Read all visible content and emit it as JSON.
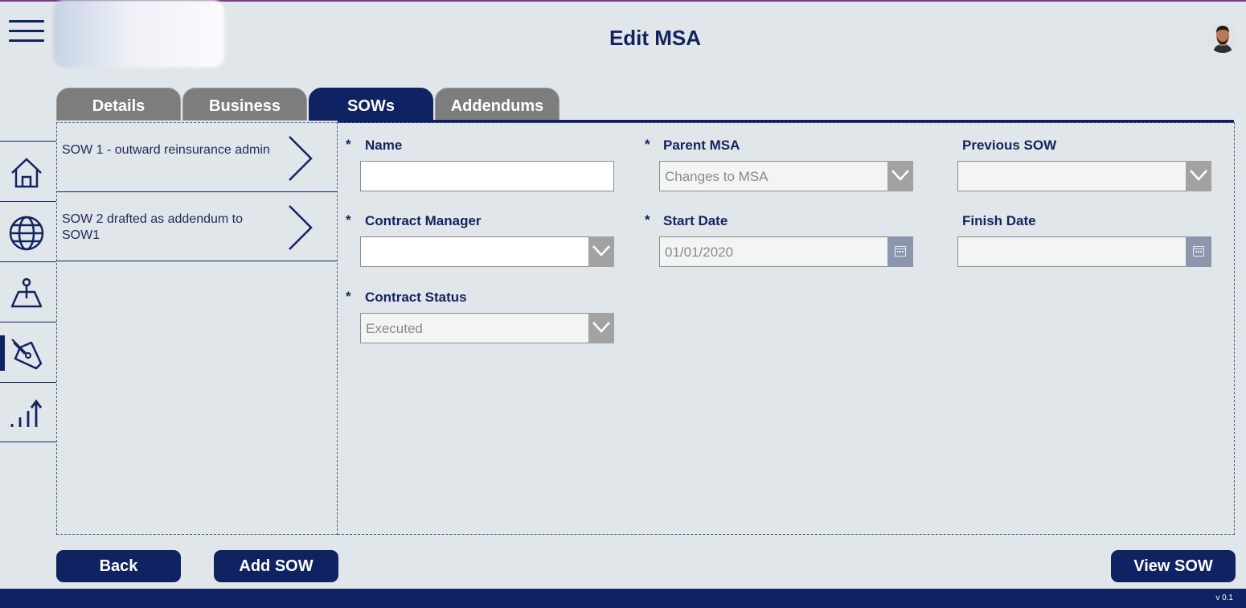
{
  "header": {
    "title": "Edit MSA"
  },
  "tabs": [
    {
      "label": "Details",
      "active": false
    },
    {
      "label": "Business",
      "active": false
    },
    {
      "label": "SOWs",
      "active": true
    },
    {
      "label": "Addendums",
      "active": false
    }
  ],
  "sidenav": {
    "items": [
      {
        "icon": "home-icon",
        "active": false
      },
      {
        "icon": "globe-icon",
        "active": false
      },
      {
        "icon": "map-pin-icon",
        "active": false
      },
      {
        "icon": "pen-nib-icon",
        "active": true
      },
      {
        "icon": "chart-trend-icon",
        "active": false
      }
    ]
  },
  "sow_list": [
    {
      "label": "SOW 1 - outward reinsurance admin"
    },
    {
      "label": "SOW 2 drafted as addendum to SOW1"
    }
  ],
  "form": {
    "required_marker": "*",
    "name": {
      "label": "Name",
      "value": ""
    },
    "parent_msa": {
      "label": "Parent MSA",
      "value": "Changes to MSA"
    },
    "previous_sow": {
      "label": "Previous SOW",
      "value": ""
    },
    "contract_manager": {
      "label": "Contract Manager",
      "value": ""
    },
    "start_date": {
      "label": "Start Date",
      "value": "01/01/2020"
    },
    "finish_date": {
      "label": "Finish Date",
      "value": ""
    },
    "contract_status": {
      "label": "Contract Status",
      "value": "Executed"
    }
  },
  "buttons": {
    "back": "Back",
    "add_sow": "Add SOW",
    "view_sow": "View SOW"
  },
  "footer": {
    "version": "v 0.1"
  },
  "colors": {
    "primary": "#0f2262",
    "tab_inactive": "#7d7d7d",
    "background": "#e1e6ea"
  }
}
